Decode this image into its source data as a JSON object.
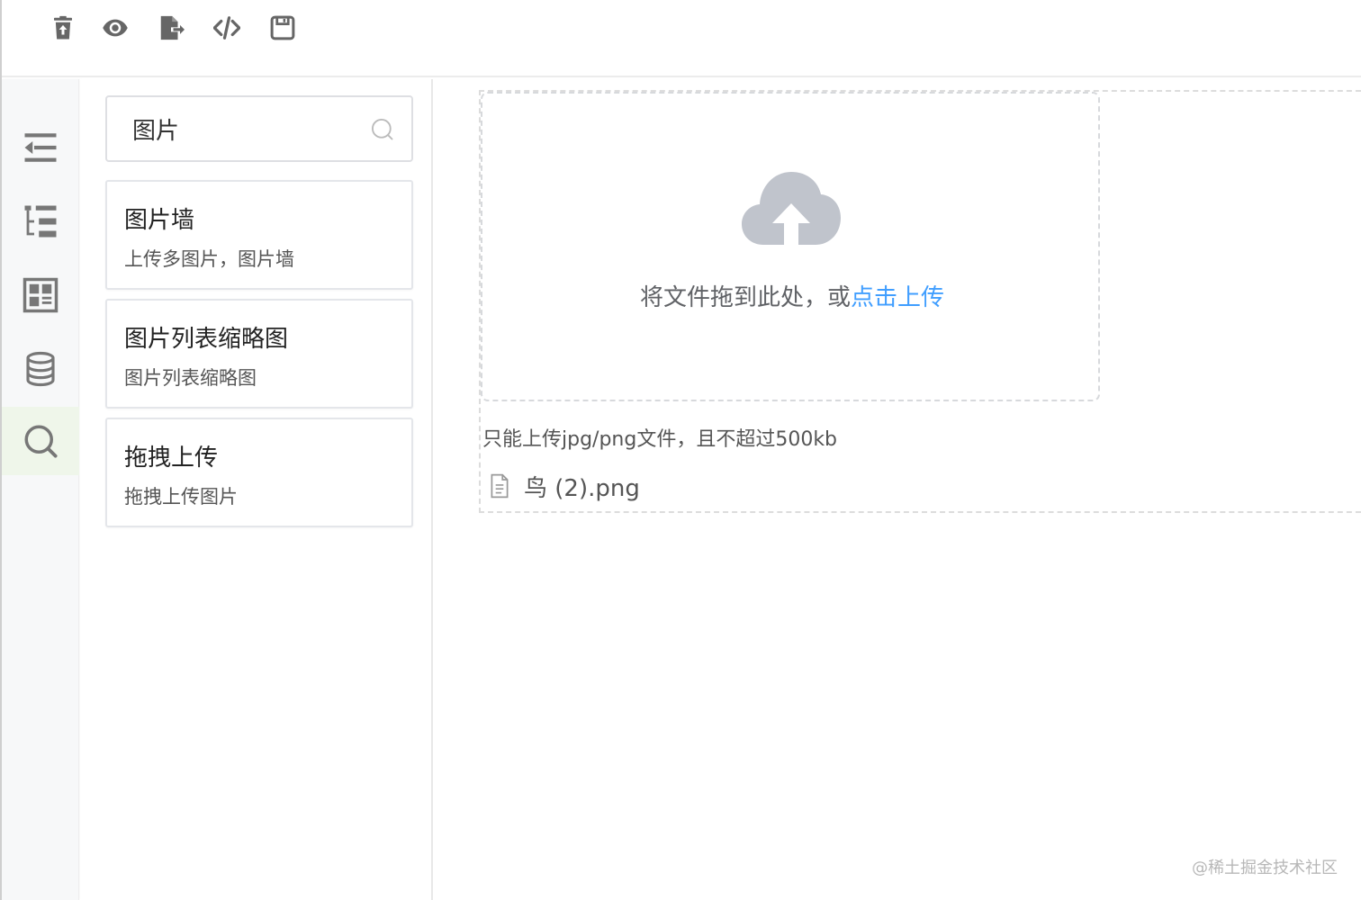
{
  "toolbar": {
    "buttons": [
      {
        "name": "clear-button",
        "icon": "trash-upload-icon"
      },
      {
        "name": "preview-button",
        "icon": "eye-icon"
      },
      {
        "name": "export-button",
        "icon": "file-export-icon"
      },
      {
        "name": "code-button",
        "icon": "code-icon"
      },
      {
        "name": "save-button",
        "icon": "floppy-disk-icon"
      }
    ]
  },
  "rail": {
    "items": [
      {
        "icon": "collapse-icon"
      },
      {
        "icon": "tree-list-icon"
      },
      {
        "icon": "layout-grid-icon"
      },
      {
        "icon": "database-icon"
      },
      {
        "icon": "search-icon",
        "active": true
      }
    ],
    "active_color": "#eff6ea"
  },
  "panel": {
    "search": {
      "value": "图片",
      "placeholder": ""
    },
    "cards": [
      {
        "title": "图片墙",
        "desc": "上传多图片，图片墙"
      },
      {
        "title": "图片列表缩略图",
        "desc": "图片列表缩略图"
      },
      {
        "title": "拖拽上传",
        "desc": "拖拽上传图片"
      }
    ]
  },
  "upload": {
    "drop_text": "将文件拖到此处，或",
    "drop_link": "点击上传",
    "tip": "只能上传jpg/png文件，且不超过500kb",
    "file_name": "鸟 (2).png",
    "link_color": "#409eff"
  },
  "watermark": "@稀土掘金技术社区"
}
